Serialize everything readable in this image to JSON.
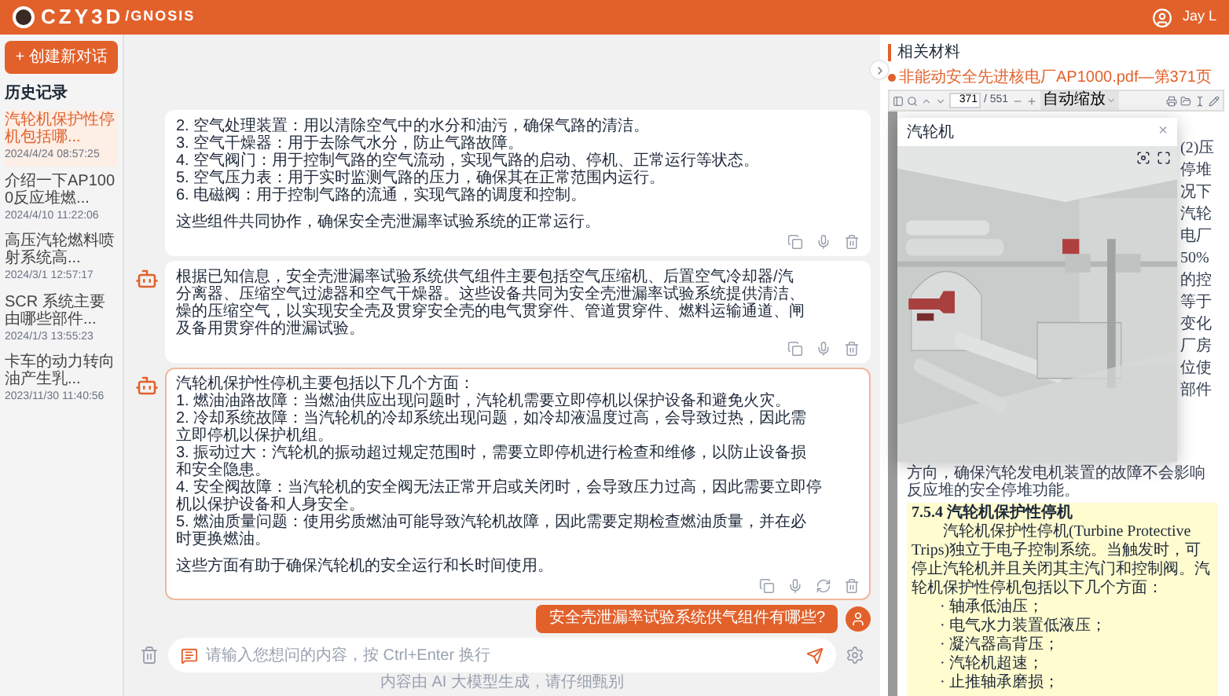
{
  "header": {
    "logo_text": "CZY3D",
    "logo_suffix": "/GNOSIS",
    "user_name": "Jay L"
  },
  "sidebar": {
    "new_chat_button": "+ 创建新对话",
    "history_title": "历史记录",
    "items": [
      {
        "title": "汽轮机保护性停机包括哪...",
        "time": "2024/4/24 08:57:25",
        "selected": true
      },
      {
        "title": "介绍一下AP1000反应堆燃...",
        "time": "2024/4/10 11:22:06",
        "selected": false
      },
      {
        "title": "高压汽轮燃料喷射系统高...",
        "time": "2024/3/1 12:57:17",
        "selected": false
      },
      {
        "title": "SCR 系统主要由哪些部件...",
        "time": "2024/1/3 13:55:23",
        "selected": false
      },
      {
        "title": "卡车的动力转向油产生乳...",
        "time": "2023/11/30 11:40:56",
        "selected": false
      }
    ]
  },
  "chat": {
    "messages": [
      {
        "kind": "bot",
        "avatar": false,
        "selected": false,
        "regenerate": false,
        "blocks": [
          [
            "2. 空气处理装置：用以清除空气中的水分和油污，确保气路的清洁。",
            "3. 空气干燥器：用于去除气水分，防止气路故障。",
            "4. 空气阀门：用于控制气路的空气流动，实现气路的启动、停机、正常运行等状态。",
            "5. 空气压力表：用于实时监测气路的压力，确保其在正常范围内运行。",
            "6. 电磁阀：用于控制气路的流通，实现气路的调度和控制。"
          ],
          [
            "这些组件共同协作，确保安全壳泄漏率试验系统的正常运行。"
          ]
        ]
      },
      {
        "kind": "bot",
        "avatar": true,
        "selected": false,
        "regenerate": false,
        "blocks": [
          [
            "根据已知信息，安全壳泄漏率试验系统供气组件主要包括空气压缩机、后置空气冷却器/汽",
            "分离器、压缩空气过滤器和空气干燥器。这些设备共同为安全壳泄漏率试验系统提供清洁、",
            "燥的压缩空气，以实现安全壳及贯穿安全壳的电气贯穿件、管道贯穿件、燃料运输通道、闸",
            "及备用贯穿件的泄漏试验。"
          ]
        ]
      },
      {
        "kind": "bot",
        "avatar": true,
        "selected": true,
        "regenerate": true,
        "blocks": [
          [
            "汽轮机保护性停机主要包括以下几个方面：",
            "1. 燃油油路故障：当燃油供应出现问题时，汽轮机需要立即停机以保护设备和避免火灾。",
            "2. 冷却系统故障：当汽轮机的冷却系统出现问题，如冷却液温度过高，会导致过热，因此需",
            "立即停机以保护机组。",
            "3. 振动过大：汽轮机的振动超过规定范围时，需要立即停机进行检查和维修，以防止设备损",
            "和安全隐患。",
            "4. 安全阀故障：当汽轮机的安全阀无法正常开启或关闭时，会导致压力过高，因此需要立即停",
            "机以保护设备和人身安全。",
            "5. 燃油质量问题：使用劣质燃油可能导致汽轮机故障，因此需要定期检查燃油质量，并在必",
            "时更换燃油。"
          ],
          [
            "这些方面有助于确保汽轮机的安全运行和长时间使用。"
          ]
        ]
      },
      {
        "kind": "user",
        "text": "安全壳泄漏率试验系统供气组件有哪些?"
      }
    ],
    "input": {
      "placeholder": "请输入您想问的内容，按 Ctrl+Enter 换行"
    },
    "footer": "内容由 AI 大模型生成，请仔细甄别"
  },
  "panel": {
    "title": "相关材料",
    "source": "非能动安全先进核电厂AP1000.pdf—第371页",
    "toolbar": {
      "page": "371",
      "page_count": "/ 551",
      "zoom": "自动缩放"
    },
    "fragments": [
      "(2)压",
      "停堆",
      "况下",
      "汽轮",
      "电厂",
      "50%",
      "的控",
      "等于",
      "变化",
      "厂房",
      "位使",
      "部件"
    ],
    "pdf_text": {
      "partial_line": "方向，确保汽轮发电机装置的故障不会影响反应堆的安全停堆功能。",
      "highlighted": true,
      "heading": "7.5.4 汽轮机保护性停机",
      "paragraph": "汽轮机保护性停机(Turbine Protective Trips)独立于电子控制系统。当触发时，可停止汽轮机并且关闭其主汽门和控制阀。汽轮机保护性停机包括以下几个方面：",
      "bullets": [
        "· 轴承低油压；",
        "· 电气水力装置低液压；",
        "· 凝汽器高背压；",
        "· 汽轮机超速；",
        "· 止推轴承磨损；"
      ]
    }
  },
  "modal": {
    "title": "汽轮机",
    "close": "×"
  }
}
